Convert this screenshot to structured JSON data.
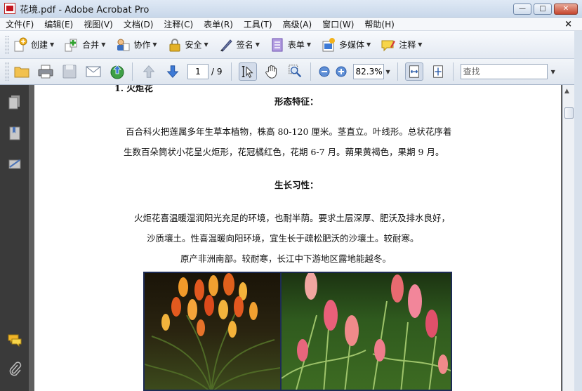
{
  "window": {
    "title": "花境.pdf - Adobe Acrobat Pro",
    "buttons": {
      "minimize": "—",
      "maximize": "□",
      "close": "✕"
    }
  },
  "menu": {
    "items": [
      "文件(F)",
      "编辑(E)",
      "视图(V)",
      "文档(D)",
      "注释(C)",
      "表单(R)",
      "工具(T)",
      "高级(A)",
      "窗口(W)",
      "帮助(H)"
    ],
    "close_doc": "×"
  },
  "toolbar1": {
    "items": [
      {
        "label": "创建",
        "icon": "create-icon"
      },
      {
        "label": "合并",
        "icon": "combine-icon"
      },
      {
        "label": "协作",
        "icon": "collaborate-icon"
      },
      {
        "label": "安全",
        "icon": "lock-icon"
      },
      {
        "label": "签名",
        "icon": "pen-icon"
      },
      {
        "label": "表单",
        "icon": "form-icon"
      },
      {
        "label": "多媒体",
        "icon": "multimedia-icon"
      },
      {
        "label": "注释",
        "icon": "comment-icon"
      }
    ]
  },
  "toolbar2": {
    "page_current": "1",
    "page_total": "/ 9",
    "zoom": "82.3%",
    "find_placeholder": "查找"
  },
  "document": {
    "heading_partial": "1.   火炬花",
    "section1_title": "形态特征：",
    "para1_line1": "百合科火把莲属多年生草本植物，株高 80-120 厘米。茎直立。叶线形。总状花序着",
    "para1_line2": "生数百朵筒状小花呈火炬形，花冠橘红色，花期 6-7 月。蒴果黄褐色，果期 9 月。",
    "section2_title": "生长习性：",
    "para2_line1": "火炬花喜温暖湿润阳光充足的环境，也耐半荫。要求土层深厚、肥沃及排水良好，",
    "para2_line2": "沙质壤土。性喜温暖向阳环境，宜生长于疏松肥沃的沙壤土。较耐寒。",
    "para2_line3": "原产非洲南部。较耐寒，长江中下游地区露地能越冬。"
  },
  "colors": {
    "nav_panel": "#3a3a3a",
    "doc_background": "#5f5f5f",
    "flower_orange": "#e0601c",
    "flower_pink": "#e9607a"
  }
}
